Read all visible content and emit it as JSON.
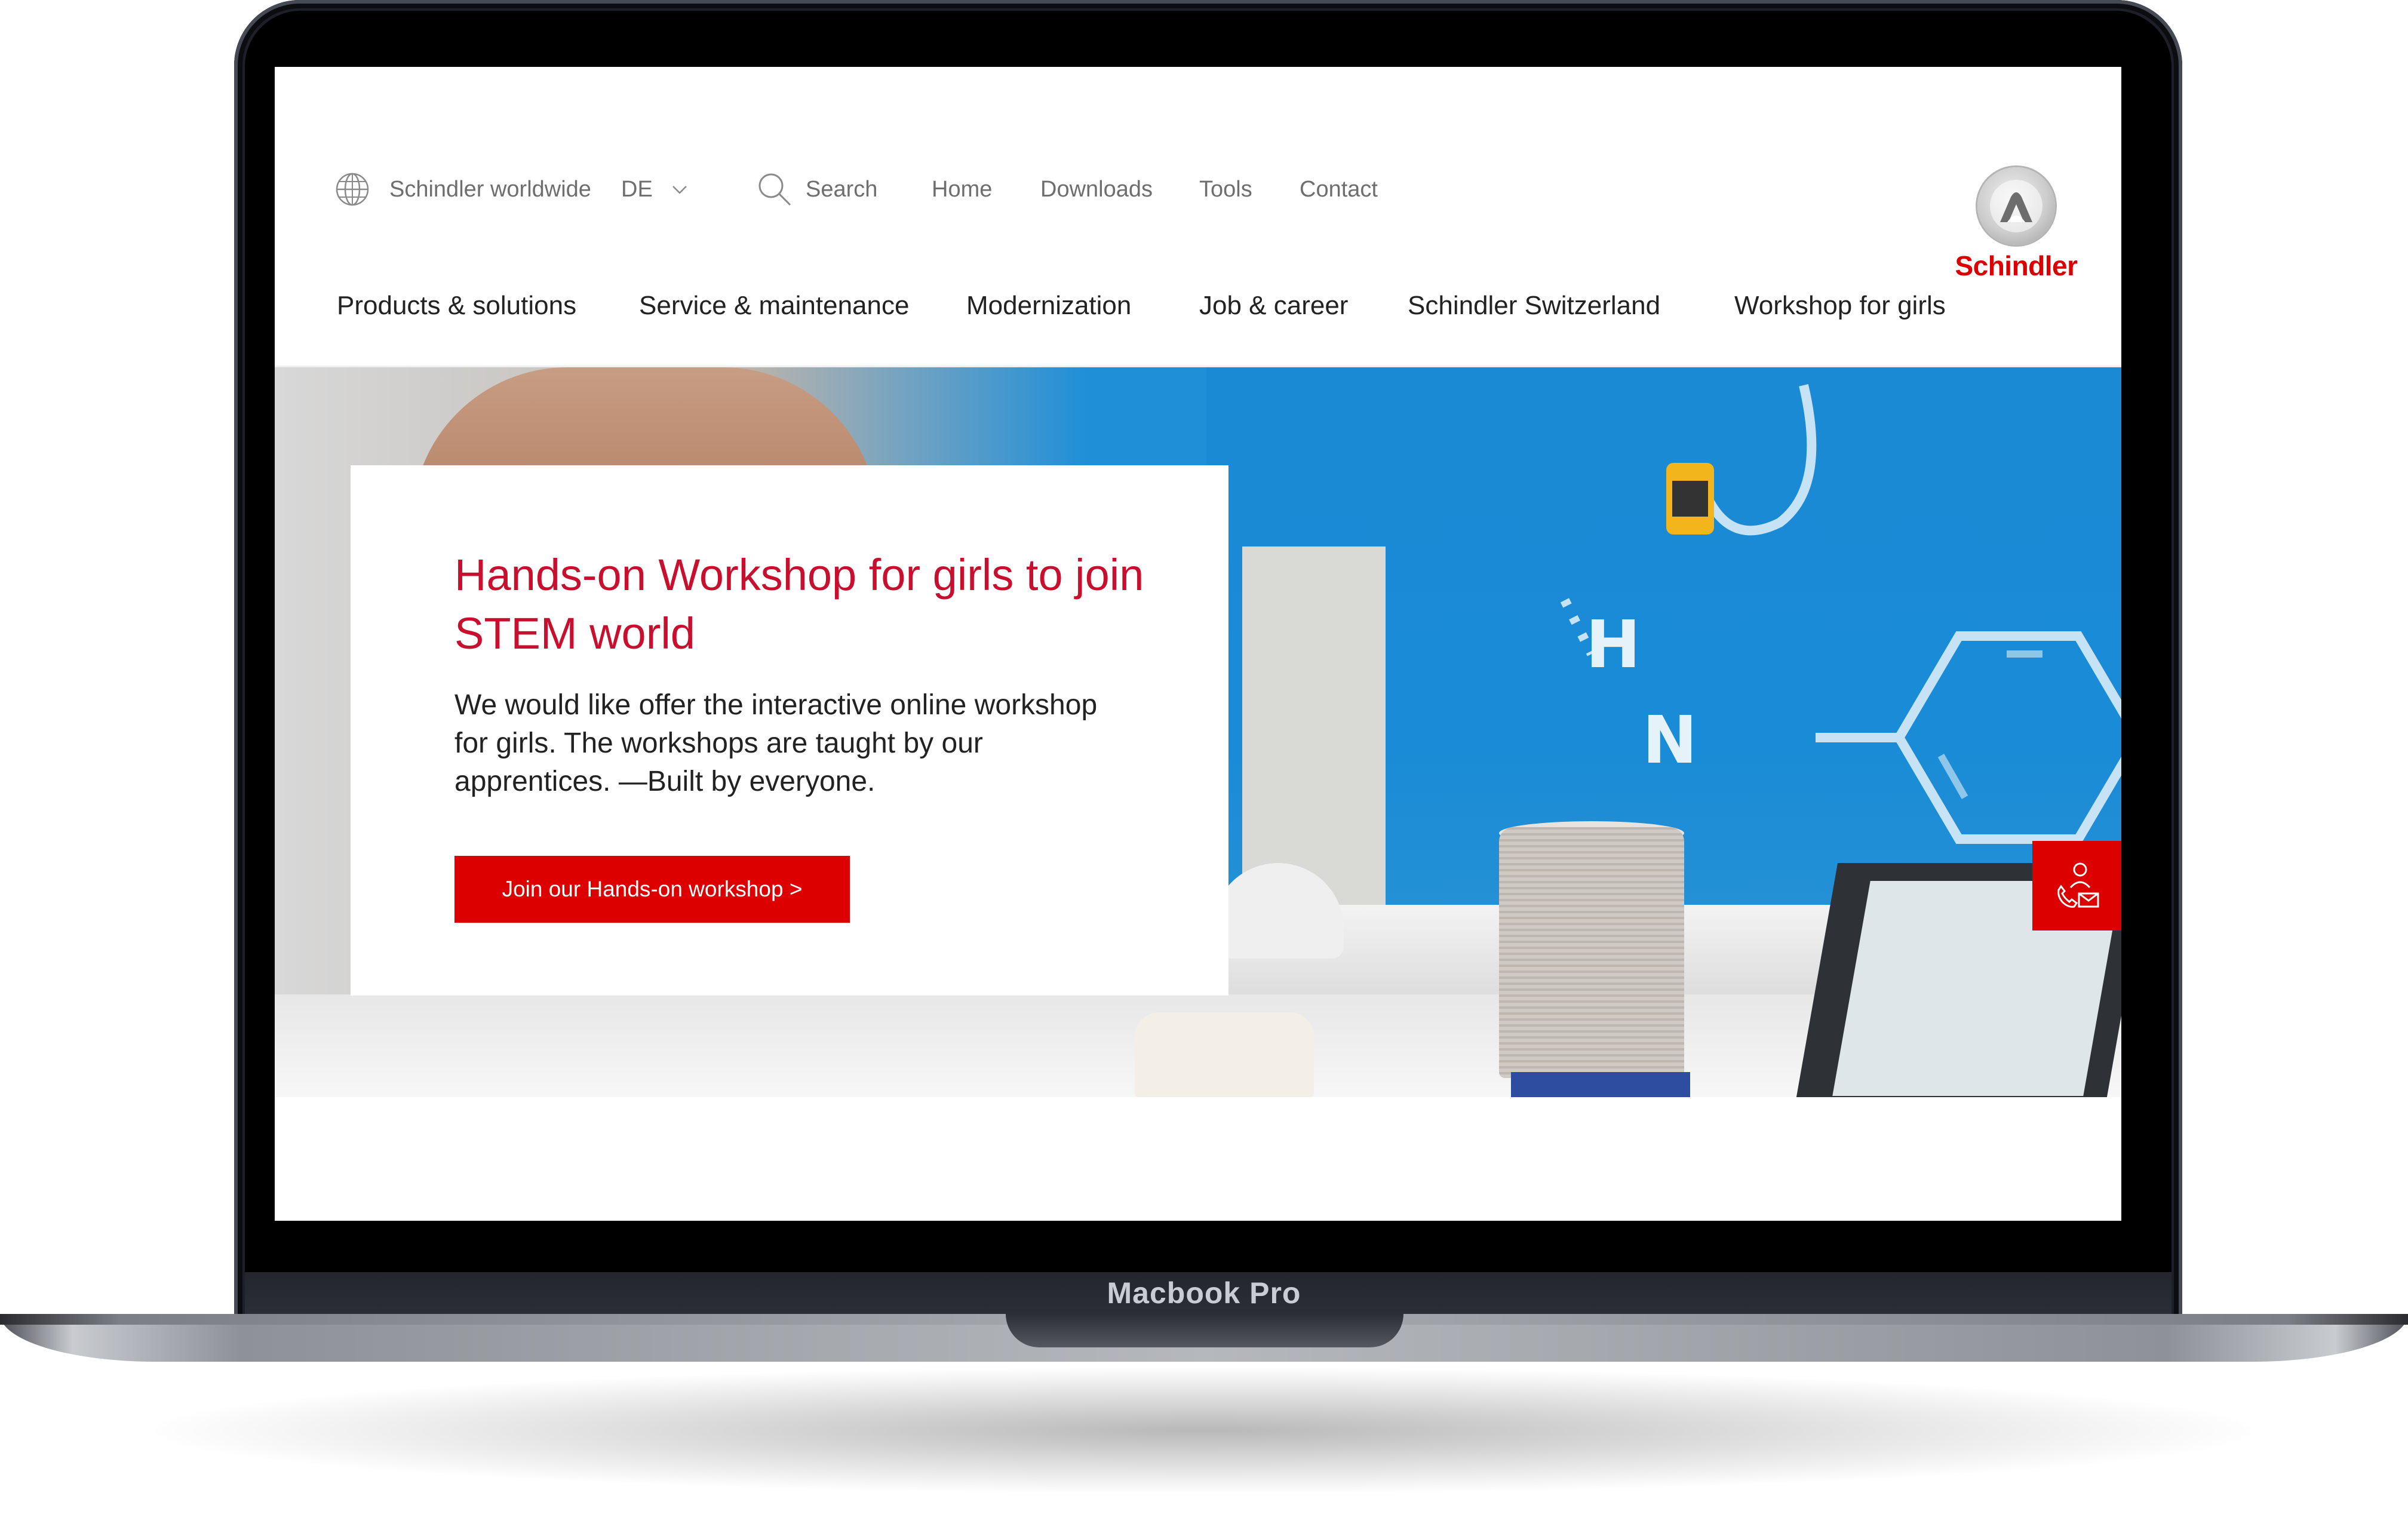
{
  "device": {
    "label": "Macbook Pro"
  },
  "header": {
    "worldwide_label": "Schindler worldwide",
    "language": "DE",
    "search_label": "Search",
    "util_links": [
      "Home",
      "Downloads",
      "Tools",
      "Contact"
    ],
    "logo_text": "Schindler"
  },
  "main_nav": {
    "items": [
      "Products & solutions",
      "Service & maintenance",
      "Modernization",
      "Job & career",
      "Schindler Switzerland",
      "Workshop for girls"
    ]
  },
  "hero": {
    "title": "Hands-on Workshop for girls to join STEM world",
    "body": "We would like offer the interactive online workshop for girls. The workshops are taught by our apprentices. —Built by everyone.",
    "cta_label": "Join our Hands-on workshop >",
    "wall_letters": [
      "H",
      "N"
    ]
  },
  "icons": {
    "globe": "globe-icon",
    "search": "search-icon",
    "language_dropdown": "chevron-down-icon",
    "contact": "contact-phone-mail-icon",
    "logo": "schindler-logo-icon"
  },
  "colors": {
    "brand_red": "#dc0000",
    "title_red": "#c8102e",
    "nav_text": "#222222",
    "util_text": "#6e6e6e",
    "hero_wall_blue": "#1a8ad5"
  }
}
